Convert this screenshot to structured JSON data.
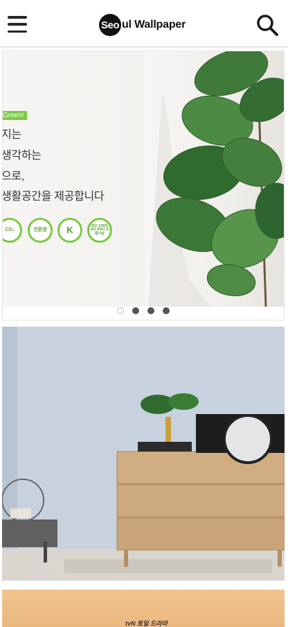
{
  "header": {
    "logo_badge": "Seo",
    "logo_rest": "ul Wallpaper",
    "menu_icon": "hamburger-menu-icon",
    "search_icon": "search-icon"
  },
  "slider": {
    "tag": "Green!",
    "lines": [
      "지는",
      "생각하는",
      "으로,",
      "생활공간을 제공합니다"
    ],
    "badges": [
      "CO₂",
      "친환경",
      "K",
      "ISO 14001 ISO 9001 인증기관"
    ],
    "dot_count": 4,
    "active_dot": 0
  },
  "cards": [
    {
      "name": "living-room-wallpaper"
    },
    {
      "name": "tvn-drama-wallpaper",
      "label": "tvN 토일 드라마"
    }
  ],
  "colors": {
    "accent_green": "#7ac943",
    "wall_blue": "#c9d3e0"
  }
}
